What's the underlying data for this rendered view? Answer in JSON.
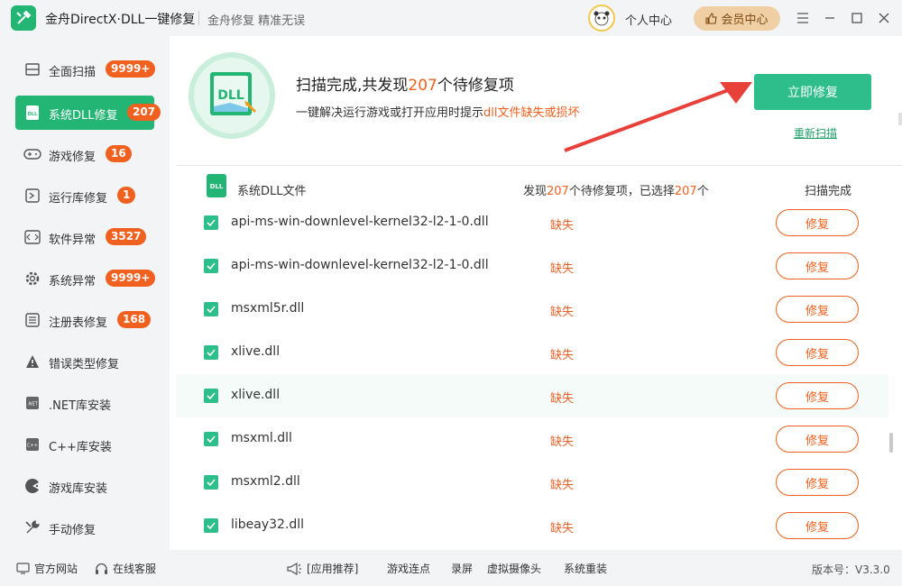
{
  "titlebar": {
    "app_title": "金舟DirectX·DLL一键修复",
    "subtitle": "金舟修复 精准无误",
    "personal_center": "个人中心",
    "vip_center": "会员中心"
  },
  "sidebar": {
    "items": [
      {
        "label": "全面扫描",
        "badge": "9999+",
        "icon": "scan-icon"
      },
      {
        "label": "系统DLL修复",
        "badge": "207",
        "icon": "dll-icon"
      },
      {
        "label": "游戏修复",
        "badge": "16",
        "icon": "gamepad-icon"
      },
      {
        "label": "运行库修复",
        "badge": "1",
        "icon": "runtime-icon"
      },
      {
        "label": "软件异常",
        "badge": "3527",
        "icon": "code-icon"
      },
      {
        "label": "系统异常",
        "badge": "9999+",
        "icon": "gear-icon"
      },
      {
        "label": "注册表修复",
        "badge": "168",
        "icon": "list-icon"
      },
      {
        "label": "错误类型修复",
        "badge": "",
        "icon": "warning-icon"
      },
      {
        "label": ".NET库安装",
        "badge": "",
        "icon": "net-icon"
      },
      {
        "label": "C++库安装",
        "badge": "",
        "icon": "cpp-icon"
      },
      {
        "label": "游戏库安装",
        "badge": "",
        "icon": "pacman-icon"
      },
      {
        "label": "手动修复",
        "badge": "",
        "icon": "wrench-icon"
      }
    ]
  },
  "header": {
    "title_prefix": "扫描完成,共发现",
    "title_count": "207",
    "title_suffix": "个待修复项",
    "desc_prefix": "一键解决运行游戏或打开应用时提示",
    "desc_highlight": "dll文件缺失或损坏",
    "fix_now": "立即修复",
    "rescan": "重新扫描",
    "icon_text": "DLL"
  },
  "list": {
    "title": "系统DLL文件",
    "found_prefix": "发现",
    "found_count": "207",
    "found_mid": "个待修复项，已选择",
    "selected_count": "207",
    "found_suffix": "个",
    "status": "扫描完成",
    "rows": [
      {
        "file": "api-ms-win-downlevel-kernel32-l2-1-0.dll",
        "status": "缺失",
        "action": "修复"
      },
      {
        "file": "api-ms-win-downlevel-kernel32-l2-1-0.dll",
        "status": "缺失",
        "action": "修复"
      },
      {
        "file": "msxml5r.dll",
        "status": "缺失",
        "action": "修复"
      },
      {
        "file": "xlive.dll",
        "status": "缺失",
        "action": "修复"
      },
      {
        "file": "xlive.dll",
        "status": "缺失",
        "action": "修复"
      },
      {
        "file": "msxml.dll",
        "status": "缺失",
        "action": "修复"
      },
      {
        "file": "msxml2.dll",
        "status": "缺失",
        "action": "修复"
      },
      {
        "file": "libeay32.dll",
        "status": "缺失",
        "action": "修复"
      }
    ]
  },
  "footer": {
    "website": "官方网站",
    "support": "在线客服",
    "app_recommend": "[应用推荐]",
    "links": [
      "游戏连点",
      "录屏",
      "虚拟摄像头",
      "系统重装"
    ],
    "version": "版本号：V3.3.0"
  },
  "colors": {
    "accent": "#22b573",
    "warning": "#f0601e",
    "button": "#2dbe8c"
  }
}
